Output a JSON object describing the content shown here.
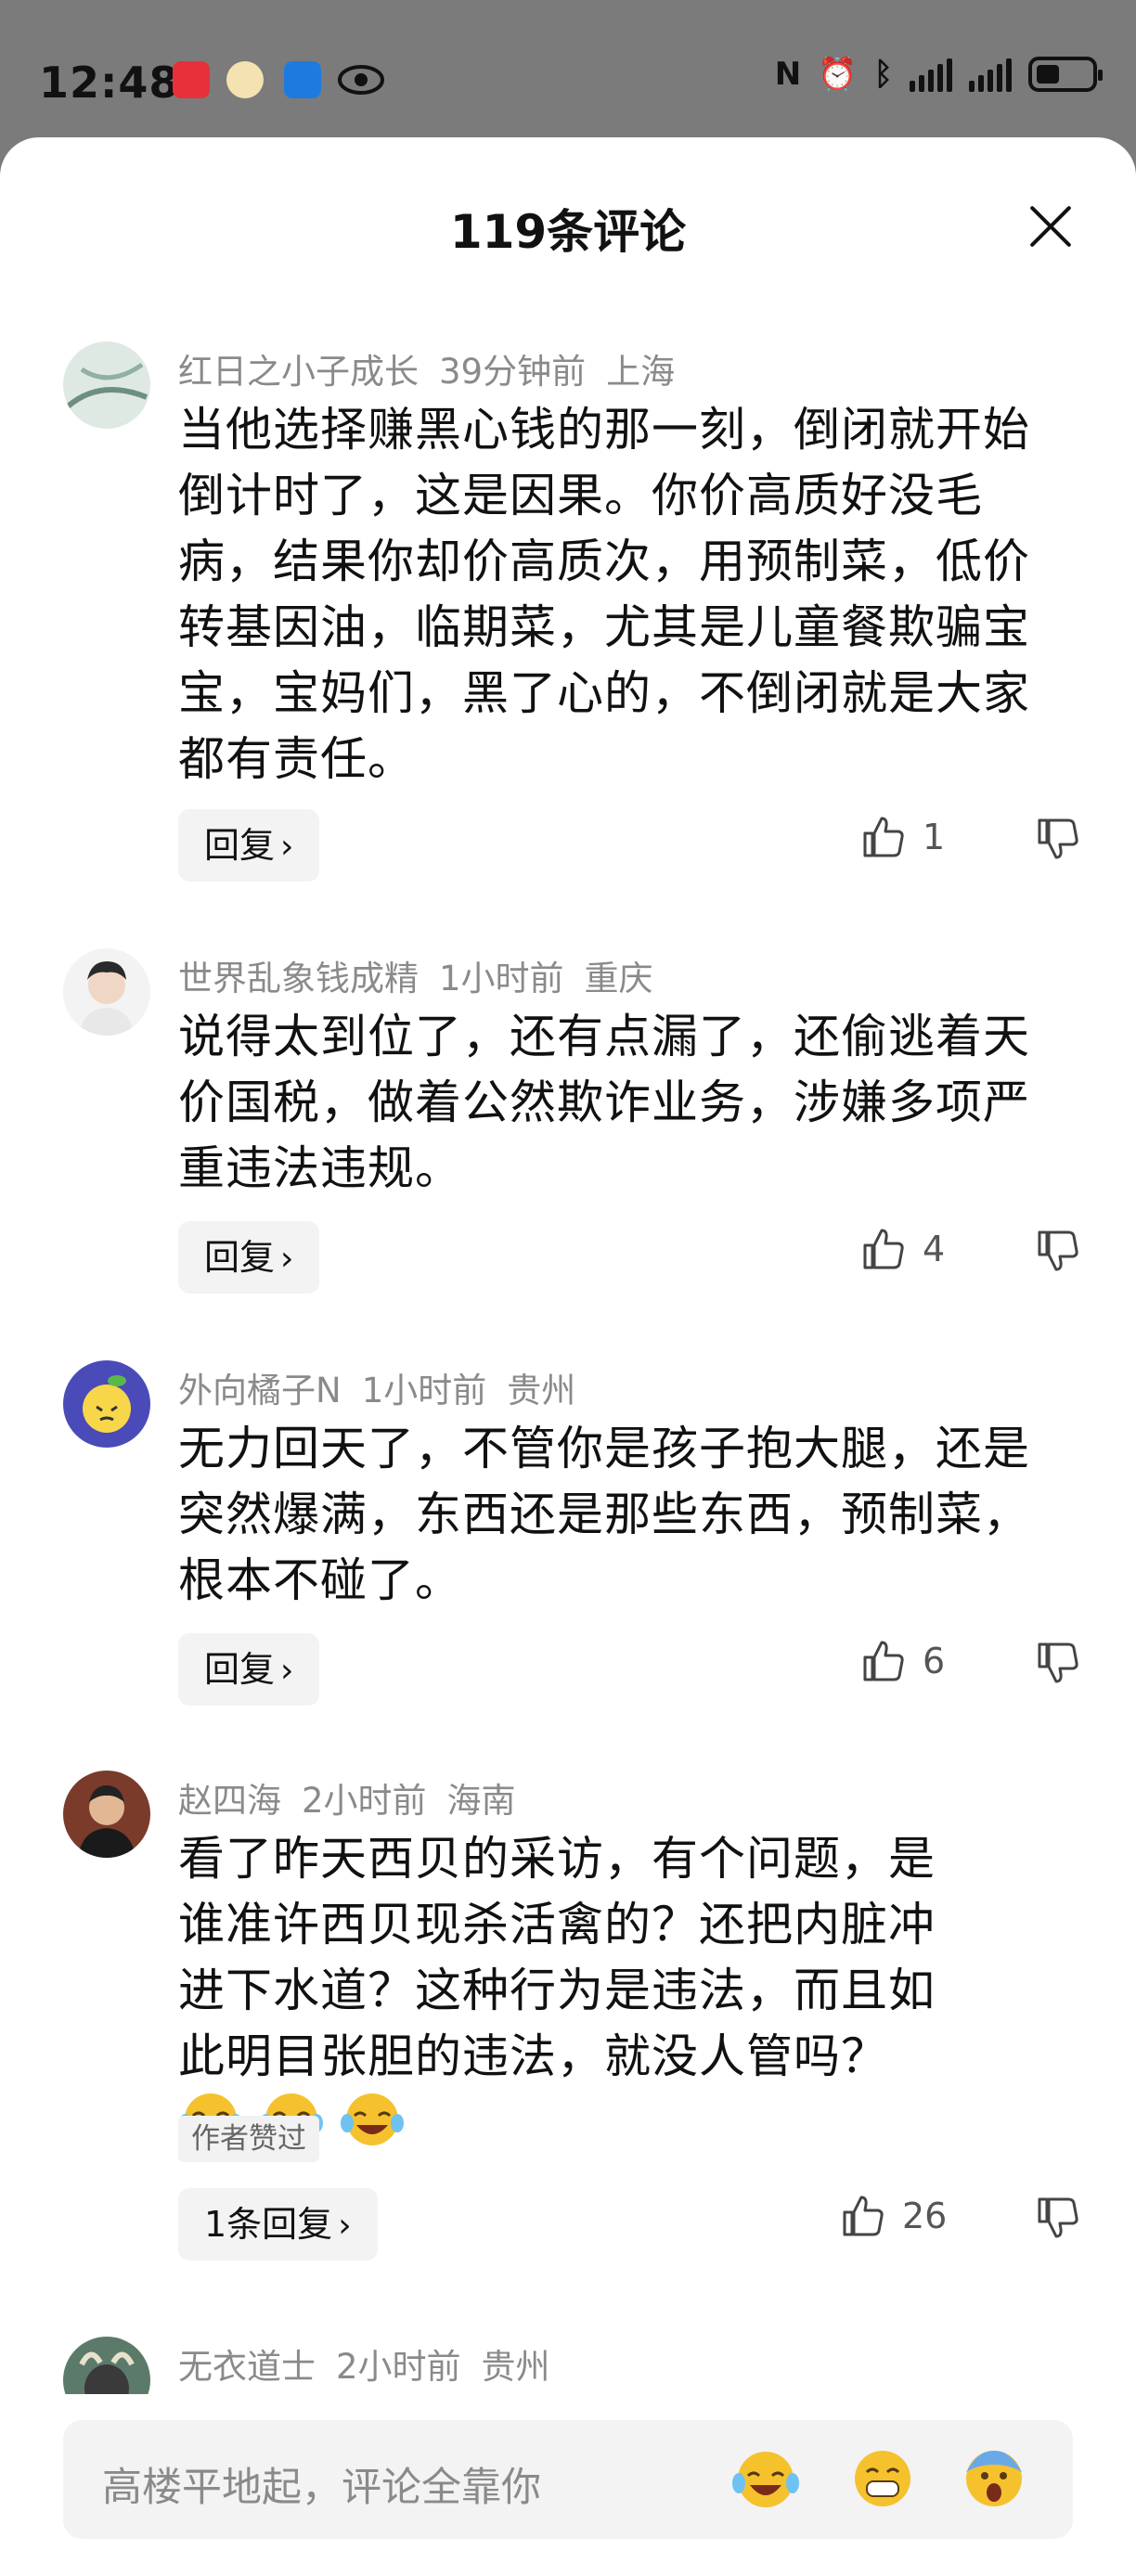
{
  "status_bar": {
    "time": "12:48",
    "nfc_glyph": "N",
    "alarm_glyph": "⏰",
    "bt_glyph": "ᛒ",
    "app_icons": [
      "app-red-icon",
      "app-yellow-icon",
      "app-blue-icon",
      "eye-icon"
    ]
  },
  "sheet": {
    "title": "119条评论",
    "close_icon": "close-icon"
  },
  "comments": [
    {
      "user": "红日之小子成长",
      "time": "39分钟前",
      "location": "上海",
      "text": "当他选择赚黑心钱的那一刻，倒闭就开始倒计时了，这是因果。你价高质好没毛病，结果你却价高质次，用预制菜，低价转基因油，临期菜，尤其是儿童餐欺骗宝宝，宝妈们，黑了心的，不倒闭就是大家都有责任。",
      "reply_label": "回复",
      "likes": "1"
    },
    {
      "user": "世界乱象钱成精",
      "time": "1小时前",
      "location": "重庆",
      "text": "说得太到位了，还有点漏了，还偷逃着天价国税，做着公然欺诈业务，涉嫌多项严重违法违规。",
      "reply_label": "回复",
      "likes": "4"
    },
    {
      "user": "外向橘子N",
      "time": "1小时前",
      "location": "贵州",
      "text": "无力回天了，不管你是孩子抱大腿，还是突然爆满，东西还是那些东西，预制菜，根本不碰了。",
      "reply_label": "回复",
      "likes": "6"
    },
    {
      "user": "赵四海",
      "time": "2小时前",
      "location": "海南",
      "text": "看了昨天西贝的采访，有个问题，是谁准许西贝现杀活禽的？还把内脏冲进下水道？这种行为是违法，而且如此明目张胆的违法，就没人管吗？",
      "author_liked": "作者赞过",
      "reply_label": "1条回复",
      "likes": "26"
    },
    {
      "user": "无衣道士",
      "time": "2小时前",
      "location": "贵州"
    }
  ],
  "input": {
    "placeholder": "高楼平地起，评论全靠你"
  },
  "colors": {
    "background": "#7b7b7b",
    "sheet": "#ffffff",
    "meta_text": "#8a8a8a",
    "chip": "#f3f3f3"
  }
}
